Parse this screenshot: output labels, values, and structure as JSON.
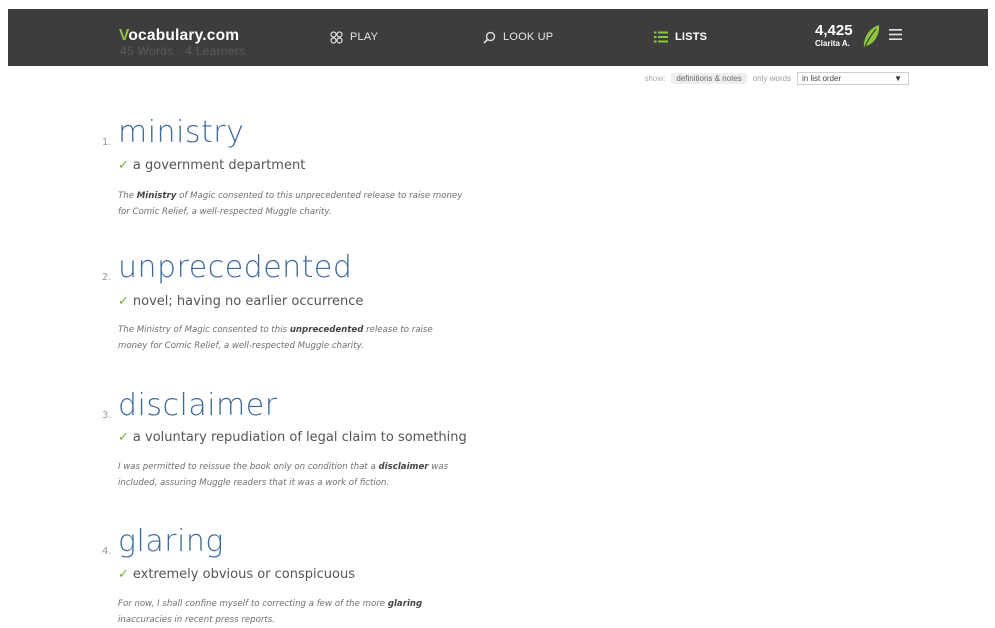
{
  "header": {
    "brand_v": "V",
    "brand_rest": "ocabulary.com",
    "ghost_text": "45 Words · 4 Learners",
    "nav": [
      {
        "label": "PLAY",
        "icon": "play-icon"
      },
      {
        "label": "LOOK UP",
        "icon": "search-icon"
      },
      {
        "label": "LISTS",
        "icon": "list-icon"
      }
    ],
    "points": "4,425",
    "user": "Clarita A.",
    "leaf_color": "#8fc53f"
  },
  "controls": {
    "show_label": "show:",
    "defs_label": "definitions & notes",
    "only_words_label": "only words",
    "order_value": "in list order"
  },
  "entries": [
    {
      "num": "1.",
      "word": "ministry",
      "definition": "a government department",
      "example_before": "The ",
      "example_bold": "Ministry",
      "example_after": " of Magic consented to this unprecedented release to raise money for Comic Relief, a well-respected Muggle charity."
    },
    {
      "num": "2.",
      "word": "unprecedented",
      "definition": "novel; having no earlier occurrence",
      "example_before": "The Ministry of Magic consented to this ",
      "example_bold": "unprecedented",
      "example_after": " release to raise money for Comic Relief, a well-respected Muggle charity."
    },
    {
      "num": "3.",
      "word": "disclaimer",
      "definition": "a voluntary repudiation of legal claim to something",
      "example_before": "I was permitted to reissue the book only on condition that a ",
      "example_bold": "disclaimer",
      "example_after": " was included, assuring Muggle readers that it was a work of fiction."
    },
    {
      "num": "4.",
      "word": "glaring",
      "definition": "extremely obvious or conspicuous",
      "example_before": "For now, I shall confine myself to correcting a few of the more ",
      "example_bold": "glaring",
      "example_after": " inaccuracies in recent press reports."
    }
  ],
  "colors": {
    "topbar": "#3d3d3d",
    "word": "#3e6a9b",
    "check": "#6fae2c"
  }
}
